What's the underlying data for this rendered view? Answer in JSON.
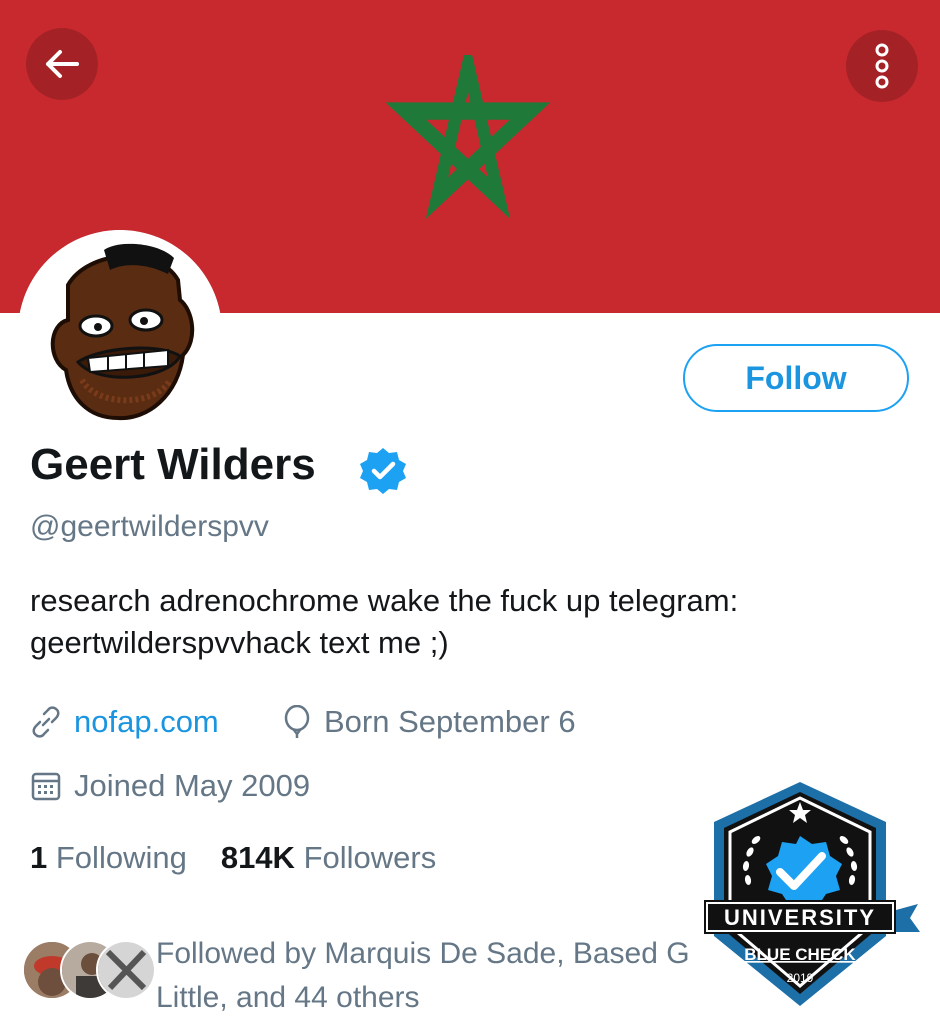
{
  "header": {
    "back_icon": "arrow-left-icon",
    "more_icon": "overflow-dots-icon",
    "banner_colors": {
      "field": "#c8292f",
      "star": "#1f7a3a"
    }
  },
  "profile": {
    "follow_label": "Follow",
    "name": "Geert Wilders",
    "verified_icon": "verified-badge-icon",
    "handle": "@geertwilderspvv",
    "bio_line1": "research adrenochrome wake the fuck up telegram:",
    "bio_line2": "geertwilderspvvhack text me ;)",
    "website": "nofap.com",
    "birthday": "Born September 6",
    "joined": "Joined May 2009",
    "following_count": "1",
    "following_label": "Following",
    "followers_count": "814K",
    "followers_label": "Followers",
    "followed_by_line1": "Followed by Marquis De Sade, Based G",
    "followed_by_line2": "Little, and 44 others"
  },
  "watermark": {
    "title": "UNIVERSITY",
    "subtitle": "BLUE CHECK",
    "year": "2019"
  },
  "colors": {
    "accent": "#1da1f2",
    "muted": "#657786",
    "text": "#14171a"
  }
}
